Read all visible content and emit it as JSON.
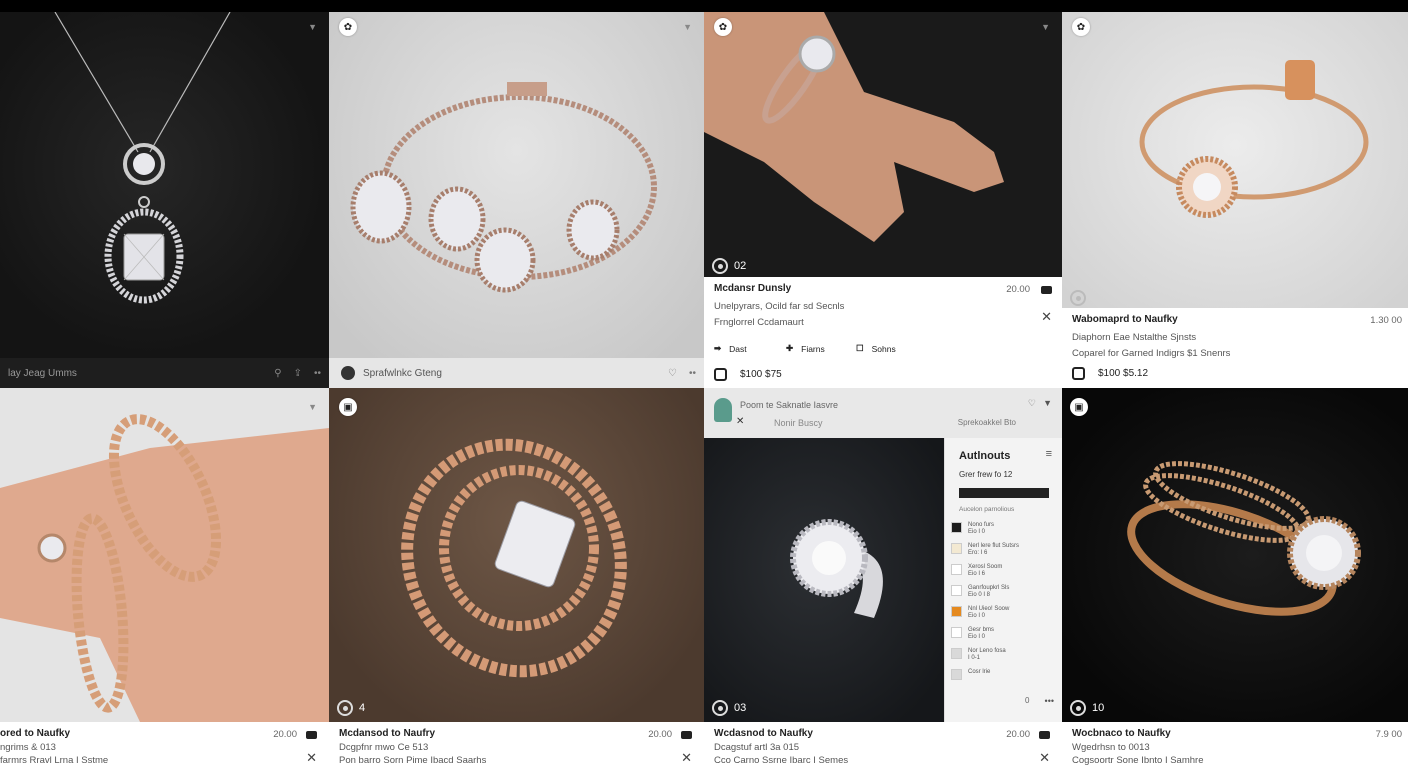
{
  "tiles": [
    {
      "caption": "lay Jeag Umms"
    },
    {
      "caption": "Sprafwlnkc Gteng"
    },
    {
      "counter": "02",
      "title": "Mcdansr Dunsly",
      "price": "20.00",
      "line1": "Unelpyrars, Ocild far sd Secnls",
      "line2": "Frnglorrel Ccdamaurt",
      "actions": [
        "Dast",
        "Fiarns",
        "Sohns"
      ],
      "footer": "$100 $75"
    },
    {
      "title": "Wabomaprd to Naufky",
      "price": "1.30 00",
      "line1": "Diaphorn Eae Nstalthe Sjnsts",
      "line2": "Coparel for Garned Indigrs $1 Snenrs",
      "footer": "$100 $5.12"
    },
    {
      "counter": "",
      "title": "ored to Naufky",
      "price": "20.00",
      "line1": "ngrims & 013",
      "line2": "farmrs Rravl Lrna I Sstme"
    },
    {
      "counter": "4",
      "title": "Mcdansod to Naufry",
      "price": "20.00",
      "line1": "Dcgpfnr mwo Ce 513",
      "line2": "Pon barro Sorn Pime Ibacd Saarhs"
    },
    {
      "counter": "03",
      "title": "Wcdasnod to Naufky",
      "price": "20.00",
      "line1": "Dcagstuf artl 3a 015",
      "line2": "Cco Carno Ssrne Ibarc I Semes",
      "header_name": "Poom te Saknatle Iasvre",
      "header_sub": "Nonir Buscy",
      "header_right": "Sprekoakkel Bto",
      "panel": {
        "title": "Autlnouts",
        "subtitle": "Grer frew fo 12",
        "section": "Aucelon parnolious",
        "rows": [
          {
            "l1": "Nono furs",
            "l2": "Eio I 0",
            "color": "#1c1c1c"
          },
          {
            "l1": "Nerl lere flut Sutsrs",
            "l2": "Ero: I 6",
            "color": "#f3e9d2"
          },
          {
            "l1": "Xerosl Soom",
            "l2": "Eio I 6",
            "color": "#ffffff"
          },
          {
            "l1": "Ganrfoupkrl Sls",
            "l2": "Eio 0 I 8",
            "color": "#ffffff"
          },
          {
            "l1": "Nnl Uieo! Soow",
            "l2": "Eio I 0",
            "color": "#e58a1f"
          },
          {
            "l1": "Gesr bms",
            "l2": "Eio I 0",
            "color": "#ffffff"
          },
          {
            "l1": "Nor Leno fosa",
            "l2": "I 0-1",
            "color": "#d9d9d9"
          },
          {
            "l1": "Cosr lrie",
            "l2": "",
            "color": "#d9d9d9"
          }
        ],
        "footer": "0"
      }
    },
    {
      "counter": "10",
      "title": "Wocbnaco to Naufky",
      "price": "7.9 00",
      "line1": "Wgedrhsn to 0013",
      "line2": "Cogsoortr Sone Ibnto I Samhre"
    }
  ]
}
